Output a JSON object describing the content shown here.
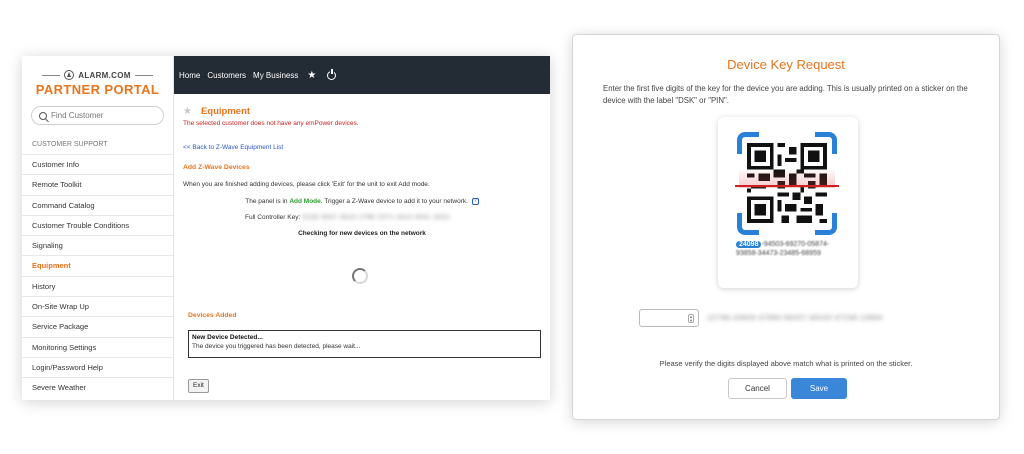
{
  "portal": {
    "logo": {
      "brand": "ALARM.COM",
      "title": "PARTNER PORTAL"
    },
    "search": {
      "placeholder": "Find Customer"
    },
    "sidebar": {
      "heading": "CUSTOMER SUPPORT",
      "items": [
        {
          "label": "Customer Info"
        },
        {
          "label": "Remote Toolkit"
        },
        {
          "label": "Command Catalog"
        },
        {
          "label": "Customer Trouble Conditions"
        },
        {
          "label": "Signaling"
        },
        {
          "label": "Equipment",
          "active": true
        },
        {
          "label": "History"
        },
        {
          "label": "On-Site Wrap Up"
        },
        {
          "label": "Service Package"
        },
        {
          "label": "Monitoring Settings"
        },
        {
          "label": "Login/Password Help"
        },
        {
          "label": "Severe Weather"
        }
      ]
    },
    "topnav": {
      "home": "Home",
      "customers": "Customers",
      "my_business": "My Business"
    },
    "content": {
      "title": "Equipment",
      "error": "The selected customer does not have any emPower devices.",
      "back_link": "<< Back to Z-Wave Equipment List",
      "add_heading": "Add Z-Wave Devices",
      "finish_text": "When you are finished adding devices, please click 'Exit' for the unit to exit Add mode.",
      "mode_prefix": "The panel is in",
      "mode_value": "Add Mode.",
      "mode_suffix": "Trigger a Z-Wave device to add it to your network.",
      "key_label": "Full Controller Key:",
      "key_value": "0236 3947 4519 1796 2371 4414 4041 3031",
      "checking": "Checking for new devices on the network",
      "devices_added": "Devices Added",
      "detected_title": "New Device Detected...",
      "detected_text": "The device you triggered has been detected, please wait...",
      "exit_label": "Exit"
    }
  },
  "dialog": {
    "title": "Device Key Request",
    "description": "Enter the first five digits of the key for the device you are adding. This is usually printed on a sticker on the device with the label \"DSK\" or \"PIN\".",
    "dsk_first": "24098",
    "dsk_rest": "-94503-69270-05874-93858-34473-23485-68959",
    "pin_value": "",
    "pin_rest": "-22796-43826-37890-56257-39102-37236-13894",
    "verify_text": "Please verify the digits displayed above match what is printed on the sticker.",
    "cancel_label": "Cancel",
    "save_label": "Save",
    "colors": {
      "accent": "#e8741d",
      "primary": "#3a86d8",
      "scan": "#cc2222"
    }
  }
}
